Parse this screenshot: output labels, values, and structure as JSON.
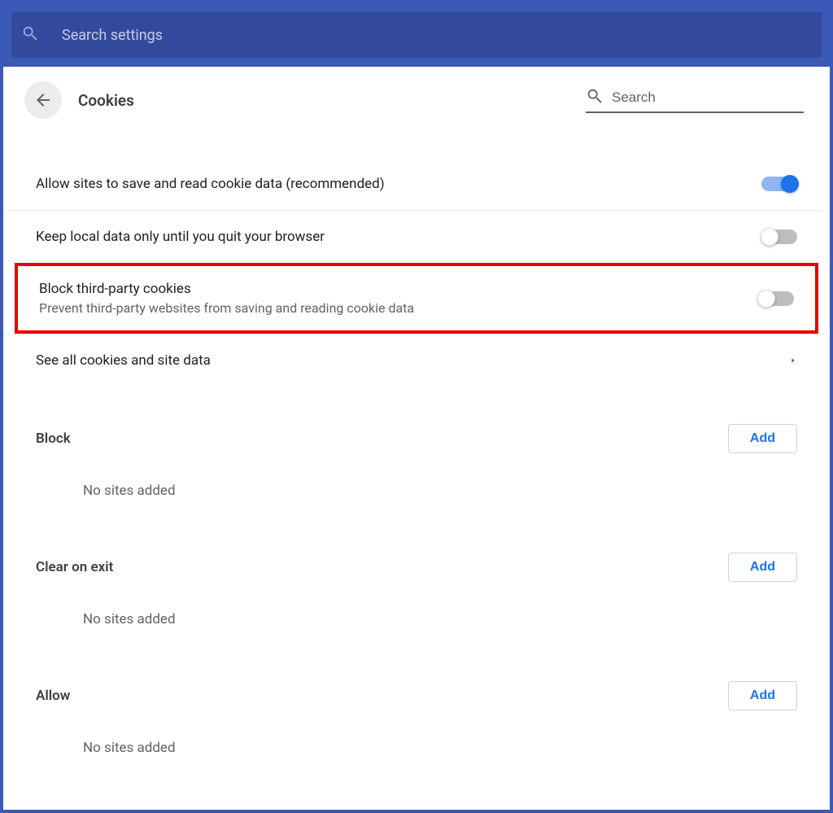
{
  "topbar": {
    "search_placeholder": "Search settings"
  },
  "header": {
    "title": "Cookies",
    "search_placeholder": "Search"
  },
  "settings": {
    "allow_cookies": {
      "label": "Allow sites to save and read cookie data (recommended)",
      "enabled": true
    },
    "keep_local": {
      "label": "Keep local data only until you quit your browser",
      "enabled": false
    },
    "block_third_party": {
      "label": "Block third-party cookies",
      "sublabel": "Prevent third-party websites from saving and reading cookie data",
      "enabled": false
    },
    "see_all": {
      "label": "See all cookies and site data"
    }
  },
  "sections": {
    "block": {
      "title": "Block",
      "add_label": "Add",
      "empty": "No sites added"
    },
    "clear_on_exit": {
      "title": "Clear on exit",
      "add_label": "Add",
      "empty": "No sites added"
    },
    "allow": {
      "title": "Allow",
      "add_label": "Add",
      "empty": "No sites added"
    }
  }
}
